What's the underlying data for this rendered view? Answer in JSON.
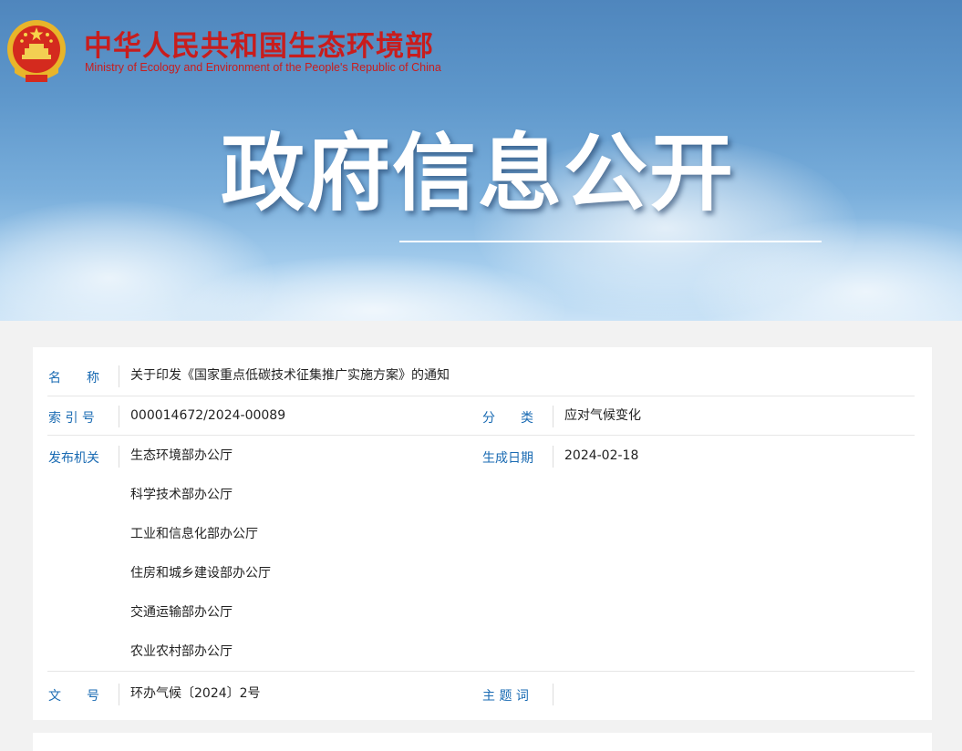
{
  "header": {
    "ministry_cn": "中华人民共和国生态环境部",
    "ministry_en": "Ministry of Ecology and Environment of the People's Republic of China",
    "emblem_icon": "national-emblem-icon",
    "banner_title": "政府信息公开"
  },
  "colors": {
    "brand_red": "#c81d1d",
    "label_blue": "#1a6bb3",
    "text": "#222222"
  },
  "info": {
    "title_label": "名　　称",
    "title_value": "关于印发《国家重点低碳技术征集推广实施方案》的通知",
    "index_label": "索 引 号",
    "index_value": "000014672/2024-00089",
    "category_label": "分　　类",
    "category_value": "应对气候变化",
    "issuer_label": "发布机关",
    "issuers": [
      "生态环境部办公厅",
      "科学技术部办公厅",
      "工业和信息化部办公厅",
      "住房和城乡建设部办公厅",
      "交通运输部办公厅",
      "农业农村部办公厅"
    ],
    "date_label": "生成日期",
    "date_value": "2024-02-18",
    "docno_label": "文　　号",
    "docno_value": "环办气候〔2024〕2号",
    "keywords_label": "主 题 词",
    "keywords_value": ""
  }
}
